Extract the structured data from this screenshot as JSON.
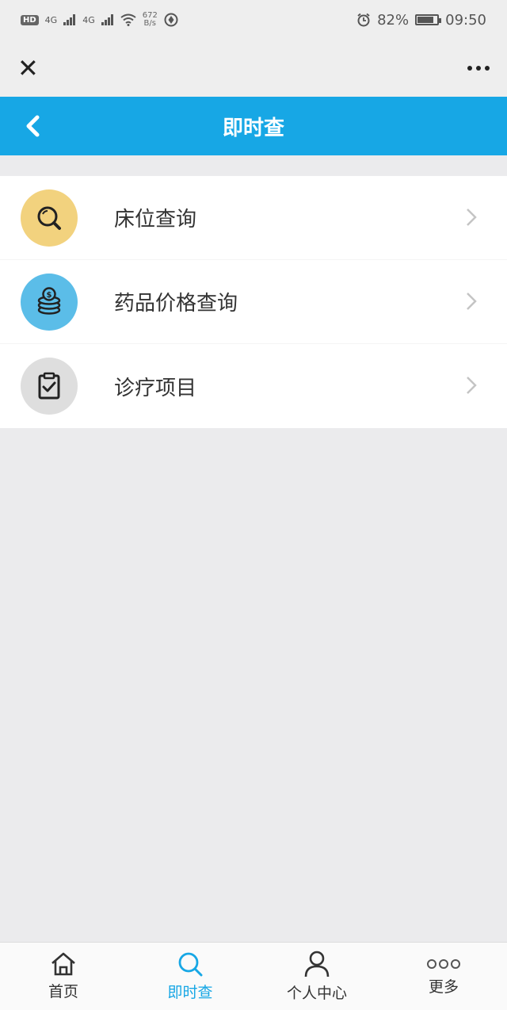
{
  "status_bar": {
    "hd": "HD",
    "net1": "4G",
    "net2": "4G",
    "speed_value": "672",
    "speed_unit": "B/s",
    "battery": "82%",
    "battery_level": 0.82,
    "time": "09:50"
  },
  "nav": {
    "title": "即时查"
  },
  "menu": [
    {
      "label": "床位查询",
      "icon": "magnifier-icon",
      "color": "#f2d27e"
    },
    {
      "label": "药品价格查询",
      "icon": "coins-icon",
      "color": "#5bbde8"
    },
    {
      "label": "诊疗项目",
      "icon": "clipboard-check-icon",
      "color": "#dedede"
    }
  ],
  "tabs": [
    {
      "label": "首页",
      "icon": "home-icon",
      "active": false
    },
    {
      "label": "即时查",
      "icon": "search-icon",
      "active": true
    },
    {
      "label": "个人中心",
      "icon": "person-icon",
      "active": false
    },
    {
      "label": "更多",
      "icon": "more-circles-icon",
      "active": false
    }
  ],
  "colors": {
    "accent": "#17a7e5",
    "background": "#ebebed"
  }
}
